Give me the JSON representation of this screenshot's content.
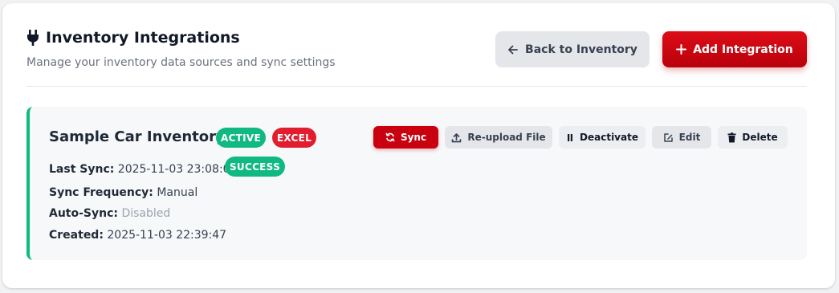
{
  "header": {
    "title": "Inventory Integrations",
    "subtitle": "Manage your inventory data sources and sync settings",
    "back_label": "Back to Inventory",
    "add_label": "Add Integration"
  },
  "integration": {
    "name": "Sample Car Inventory",
    "status_badge": "ACTIVE",
    "type_badge": "EXCEL",
    "last_sync_label": "Last Sync:",
    "last_sync_value": "2025-11-03 23:08:07",
    "last_sync_status": "SUCCESS",
    "frequency_label": "Sync Frequency:",
    "frequency_value": "Manual",
    "autosync_label": "Auto-Sync:",
    "autosync_value": "Disabled",
    "created_label": "Created:",
    "created_value": "2025-11-03 22:39:47",
    "actions": {
      "sync": "Sync",
      "reupload": "Re-upload File",
      "deactivate": "Deactivate",
      "edit": "Edit",
      "delete": "Delete"
    }
  },
  "colors": {
    "brand_red": "#c8000f",
    "success_green": "#10b981",
    "excel_red": "#e11d2e"
  },
  "icons": [
    "plug-icon",
    "arrow-left-icon",
    "plus-icon",
    "sync-icon",
    "upload-icon",
    "pause-icon",
    "edit-icon",
    "trash-icon"
  ]
}
